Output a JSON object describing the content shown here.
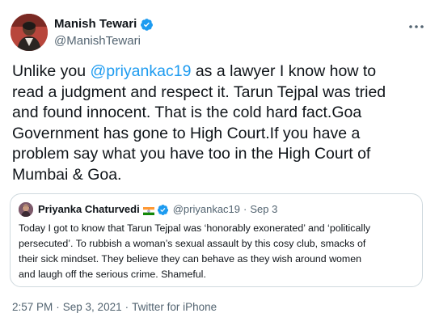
{
  "author": {
    "display_name": "Manish Tewari",
    "handle": "@ManishTewari",
    "verified": true
  },
  "tweet": {
    "lines": [
      [
        "Unlike you ",
        "@priyankac19",
        " as a lawyer I know how to"
      ],
      "read a judgment and respect it. Tarun Tejpal was tried",
      "and found innocent. That is the cold hard fact.Goa",
      "Government has gone to High Court.If you have a",
      "problem say what you have too in the High Court of",
      "Mumbai & Goa."
    ]
  },
  "quote": {
    "display_name": "Priyanka Chaturvedi",
    "handle": "@priyankac19",
    "date": "Sep 3",
    "dot": "·",
    "lines": [
      "Today I got to know that Tarun Tejpal was ‘honorably exonerated’ and ‘politically",
      "persecuted’. To rubbish a woman’s sexual assault by this cosy club, smacks of",
      "their sick mindset.  They believe they can behave as they wish around women",
      "and laugh off the serious crime. Shameful."
    ]
  },
  "meta": {
    "time": "2:57 PM",
    "dot": "·",
    "date": "Sep 3, 2021",
    "source": "Twitter for iPhone"
  },
  "icons": {
    "verified": "verified-badge-icon",
    "more": "more-options-icon",
    "flag": "india-flag-icon"
  },
  "colors": {
    "link": "#1d9bf0",
    "text": "#0f1419",
    "muted": "#536471",
    "border": "#cfd9de"
  }
}
